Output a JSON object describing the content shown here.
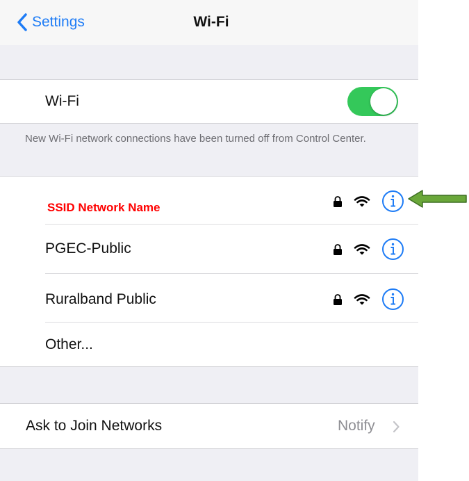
{
  "navbar": {
    "back_label": "Settings",
    "title": "Wi-Fi"
  },
  "wifi_toggle": {
    "label": "Wi-Fi",
    "on": true,
    "color": "#34c85a"
  },
  "footnote": "New Wi-Fi network connections have been turned off from Control Center.",
  "annotation": {
    "ssid_label": "SSID Network Name",
    "label_color": "#ff0000",
    "arrow_color": "#6aa73a"
  },
  "networks": [
    {
      "name": "PGEC-Public",
      "secured": true
    },
    {
      "name": "Ruralband Public",
      "secured": true
    },
    {
      "name": "Other..."
    }
  ],
  "ask_to_join": {
    "label": "Ask to Join Networks",
    "value": "Notify"
  },
  "colors": {
    "accent": "#1e7cf6",
    "background": "#efeff4"
  }
}
